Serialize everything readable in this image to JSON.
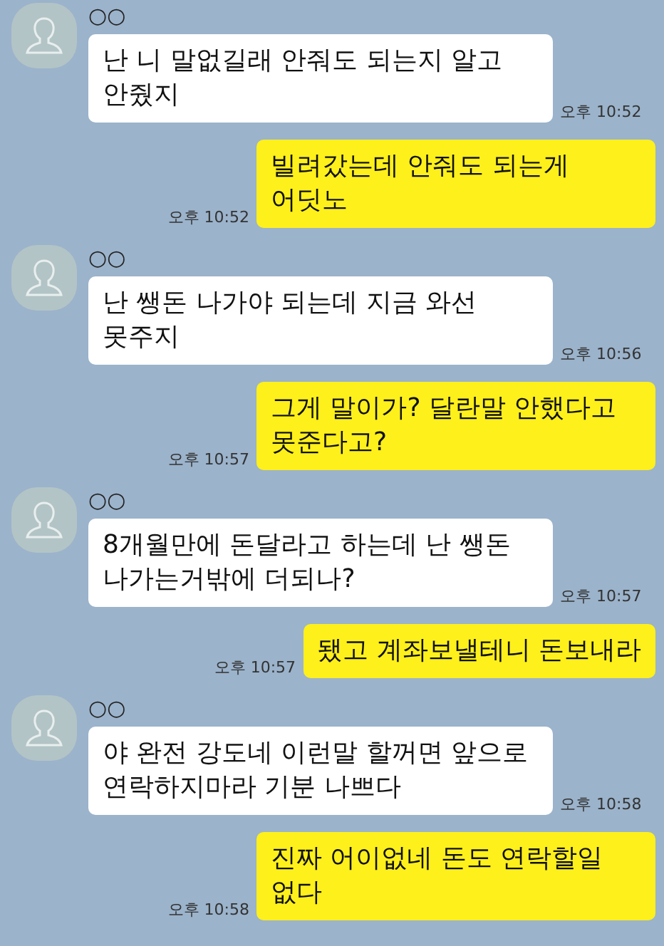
{
  "messages": [
    {
      "kind": "received",
      "sender": "○○",
      "text": "난 니 말없길래 안줘도 되는지 알고 안줬지",
      "time": "오후 10:52"
    },
    {
      "kind": "sent",
      "text": "빌려갔는데 안줘도 되는게 어딧노",
      "time": "오후 10:52"
    },
    {
      "kind": "received",
      "sender": "○○",
      "text": "난 쌩돈 나가야 되는데 지금 와선 못주지",
      "time": "오후 10:56"
    },
    {
      "kind": "sent",
      "text": "그게 말이가? 달란말 안했다고 못준다고?",
      "time": "오후 10:57"
    },
    {
      "kind": "received",
      "sender": "○○",
      "text": "8개월만에 돈달라고 하는데 난 쌩돈 나가는거밖에 더되나?",
      "time": "오후 10:57"
    },
    {
      "kind": "sent",
      "text": "됐고 계좌보낼테니 돈보내라",
      "time": "오후 10:57"
    },
    {
      "kind": "received",
      "sender": "○○",
      "text": "야 완전 강도네 이런말 할꺼면 앞으로 연락하지마라 기분 나쁘다",
      "time": "오후 10:58"
    },
    {
      "kind": "sent",
      "text": "진짜 어이없네 돈도 연락할일 없다",
      "time": "오후 10:58"
    }
  ]
}
